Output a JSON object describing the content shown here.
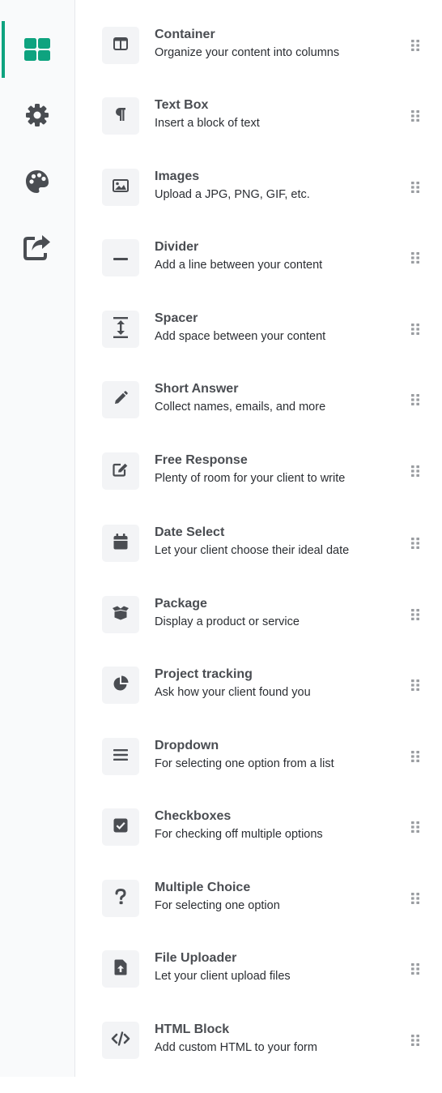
{
  "sidebar": {
    "accent": "#0ea37f",
    "icon_color": "#4a4d52",
    "items": [
      {
        "icon": "blocks-grid-icon",
        "active": true
      },
      {
        "icon": "gear-icon",
        "active": false
      },
      {
        "icon": "palette-icon",
        "active": false
      },
      {
        "icon": "share-icon",
        "active": false
      }
    ]
  },
  "blocks": [
    {
      "icon": "container-icon",
      "title": "Container",
      "description": "Organize your content into columns"
    },
    {
      "icon": "paragraph-icon",
      "title": "Text Box",
      "description": "Insert a block of text"
    },
    {
      "icon": "image-icon",
      "title": "Images",
      "description": "Upload a JPG, PNG, GIF, etc."
    },
    {
      "icon": "divider-icon",
      "title": "Divider",
      "description": "Add a line between your content"
    },
    {
      "icon": "spacer-icon",
      "title": "Spacer",
      "description": "Add space between your content"
    },
    {
      "icon": "pencil-icon",
      "title": "Short Answer",
      "description": "Collect names, emails, and more"
    },
    {
      "icon": "edit-icon",
      "title": "Free Response",
      "description": "Plenty of room for your client to write"
    },
    {
      "icon": "calendar-icon",
      "title": "Date Select",
      "description": "Let your client choose their ideal date"
    },
    {
      "icon": "box-open-icon",
      "title": "Package",
      "description": "Display a product or service"
    },
    {
      "icon": "pie-chart-icon",
      "title": "Project tracking",
      "description": "Ask how your client found you"
    },
    {
      "icon": "list-icon",
      "title": "Dropdown",
      "description": "For selecting one option from a list"
    },
    {
      "icon": "checkbox-icon",
      "title": "Checkboxes",
      "description": "For checking off multiple options"
    },
    {
      "icon": "question-icon",
      "title": "Multiple Choice",
      "description": "For selecting one option"
    },
    {
      "icon": "file-upload-icon",
      "title": "File Uploader",
      "description": "Let your client upload files"
    },
    {
      "icon": "code-icon",
      "title": "HTML Block",
      "description": "Add custom HTML to your form"
    }
  ]
}
